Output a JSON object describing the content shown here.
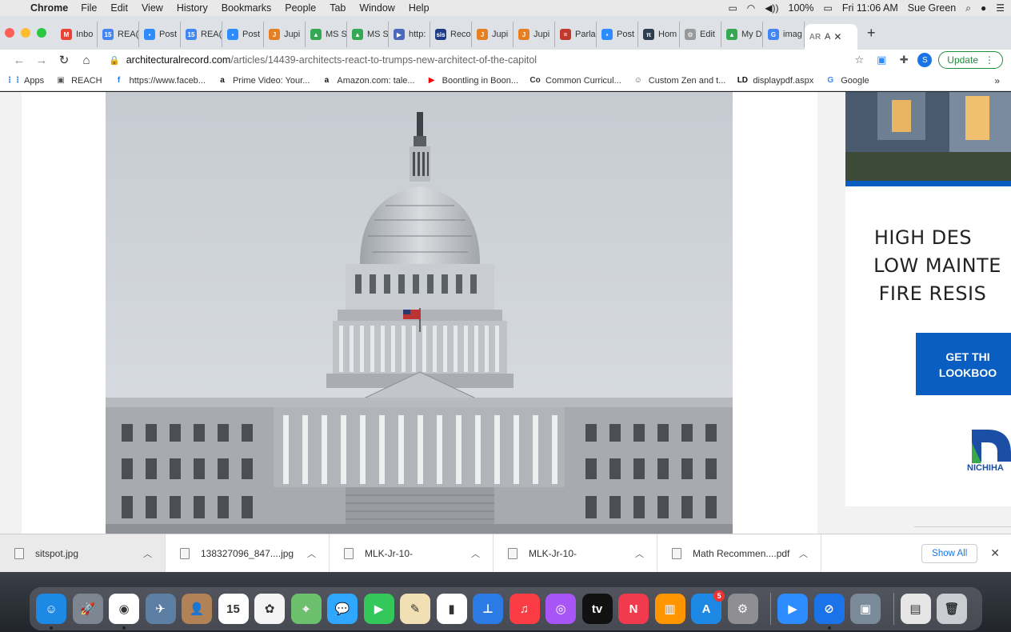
{
  "menubar": {
    "app_name": "Chrome",
    "items": [
      "File",
      "Edit",
      "View",
      "History",
      "Bookmarks",
      "People",
      "Tab",
      "Window",
      "Help"
    ],
    "battery": "100%",
    "clock": "Fri 11:06 AM",
    "user": "Sue Green"
  },
  "tabs": [
    {
      "label": "Inbo",
      "icon": "gmail-icon",
      "color": "#ea4335",
      "glyph": "M"
    },
    {
      "label": "REA(",
      "icon": "calendar-icon",
      "color": "#4285f4",
      "glyph": "15"
    },
    {
      "label": "Post",
      "icon": "zoom-icon",
      "color": "#2d8cff",
      "glyph": "▪"
    },
    {
      "label": "REA(",
      "icon": "calendar-icon",
      "color": "#4285f4",
      "glyph": "15"
    },
    {
      "label": "Post",
      "icon": "zoom-icon",
      "color": "#2d8cff",
      "glyph": "▪"
    },
    {
      "label": "Jupi",
      "icon": "jupiter-icon",
      "color": "#e67e22",
      "glyph": "J"
    },
    {
      "label": "MS S",
      "icon": "drive-icon",
      "color": "#34a853",
      "glyph": "▲"
    },
    {
      "label": "MS S",
      "icon": "drive-icon",
      "color": "#34a853",
      "glyph": "▲"
    },
    {
      "label": "http:",
      "icon": "play-icon",
      "color": "#4a69bd",
      "glyph": "▶"
    },
    {
      "label": "Reco",
      "icon": "sis-icon",
      "color": "#1f3c88",
      "glyph": "sis"
    },
    {
      "label": "Jupi",
      "icon": "jupiter-icon",
      "color": "#e67e22",
      "glyph": "J"
    },
    {
      "label": "Jupi",
      "icon": "jupiter-icon",
      "color": "#e67e22",
      "glyph": "J"
    },
    {
      "label": "Parla",
      "icon": "parla-icon",
      "color": "#c0392b",
      "glyph": "="
    },
    {
      "label": "Post",
      "icon": "zoom-icon",
      "color": "#2d8cff",
      "glyph": "▪"
    },
    {
      "label": "Hom",
      "icon": "home-icon",
      "color": "#2c3e50",
      "glyph": "π"
    },
    {
      "label": "Edit",
      "icon": "settings-icon",
      "color": "#999999",
      "glyph": "⚙"
    },
    {
      "label": "My D",
      "icon": "drive-icon",
      "color": "#34a853",
      "glyph": "▲"
    },
    {
      "label": "imag",
      "icon": "google-icon",
      "color": "#4285f4",
      "glyph": "G"
    }
  ],
  "active_tab": {
    "label": "AR A",
    "prefix": "AR"
  },
  "url": {
    "domain": "architecturalrecord.com",
    "path": "/articles/14439-architects-react-to-trumps-new-architect-of-the-capitol"
  },
  "update_button": "Update",
  "profile_initial": "S",
  "bookmarks": [
    {
      "label": "Apps",
      "icon": "apps-grid-icon",
      "glyph": "⋮⋮",
      "color": "#1a73e8"
    },
    {
      "label": "REACH",
      "icon": "folder-icon",
      "glyph": "▣",
      "color": "#555555"
    },
    {
      "label": "https://www.faceb...",
      "icon": "facebook-icon",
      "glyph": "f",
      "color": "#1877f2"
    },
    {
      "label": "Prime Video: Your...",
      "icon": "amazon-icon",
      "glyph": "a",
      "color": "#111111"
    },
    {
      "label": "Amazon.com: tale...",
      "icon": "amazon-icon",
      "glyph": "a",
      "color": "#111111"
    },
    {
      "label": "Boontling in Boon...",
      "icon": "youtube-icon",
      "glyph": "▶",
      "color": "#ff0000"
    },
    {
      "label": "Common Curricul...",
      "icon": "cc-icon",
      "glyph": "Co",
      "color": "#333333"
    },
    {
      "label": "Custom Zen and t...",
      "icon": "zen-icon",
      "glyph": "☺",
      "color": "#555555"
    },
    {
      "label": "displaypdf.aspx",
      "icon": "ld-icon",
      "glyph": "LD",
      "color": "#111111"
    },
    {
      "label": "Google",
      "icon": "google-icon",
      "glyph": "G",
      "color": "#4285f4"
    }
  ],
  "ad": {
    "lines": [
      "HIGH DES",
      "LOW MAINTE",
      "FIRE RESIS"
    ],
    "cta_line1": "GET THI",
    "cta_line2": "LOOKBOO",
    "logo_text": "NICHIHA",
    "accent": "#0a5ec2"
  },
  "downloads": [
    {
      "name": "sitspot.jpg"
    },
    {
      "name": "138327096_847....jpg"
    },
    {
      "name": "MLK-Jr-10-"
    },
    {
      "name": "MLK-Jr-10-"
    },
    {
      "name": "Math Recommen....pdf"
    }
  ],
  "show_all": "Show All",
  "dock": [
    {
      "name": "finder-icon",
      "bg": "#1e88e5",
      "glyph": "☺",
      "dot": true
    },
    {
      "name": "launchpad-icon",
      "bg": "#7d8590",
      "glyph": "🚀",
      "dot": false
    },
    {
      "name": "chrome-icon",
      "bg": "#ffffff",
      "glyph": "◉",
      "dot": true
    },
    {
      "name": "preview-icon",
      "bg": "#5d7fa3",
      "glyph": "✈",
      "dot": false
    },
    {
      "name": "contacts-icon",
      "bg": "#b08255",
      "glyph": "👤",
      "dot": false
    },
    {
      "name": "calendar-icon",
      "bg": "#ffffff",
      "glyph": "15",
      "dot": false
    },
    {
      "name": "photos-icon",
      "bg": "#f4f4f4",
      "glyph": "✿",
      "dot": false
    },
    {
      "name": "maps-icon",
      "bg": "#6cbf6c",
      "glyph": "⌖",
      "dot": false
    },
    {
      "name": "messages-icon",
      "bg": "#2fa7ff",
      "glyph": "💬",
      "dot": false
    },
    {
      "name": "facetime-icon",
      "bg": "#34c759",
      "glyph": "▶",
      "dot": false
    },
    {
      "name": "textedit-icon",
      "bg": "#f1e0b4",
      "glyph": "✎",
      "dot": false
    },
    {
      "name": "numbers-icon",
      "bg": "#ffffff",
      "glyph": "▮",
      "dot": false
    },
    {
      "name": "keynote-icon",
      "bg": "#2c7be5",
      "glyph": "⊥",
      "dot": false
    },
    {
      "name": "music-icon",
      "bg": "#fc3c44",
      "glyph": "♫",
      "dot": false
    },
    {
      "name": "podcasts-icon",
      "bg": "#a855f7",
      "glyph": "◎",
      "dot": false
    },
    {
      "name": "apple-tv-icon",
      "bg": "#111111",
      "glyph": "tv",
      "dot": false
    },
    {
      "name": "news-icon",
      "bg": "#f23a4f",
      "glyph": "N",
      "dot": false
    },
    {
      "name": "books-icon",
      "bg": "#ff9500",
      "glyph": "▥",
      "dot": false
    },
    {
      "name": "app-store-icon",
      "bg": "#1e88e5",
      "glyph": "A",
      "badge": "5",
      "dot": false
    },
    {
      "name": "system-preferences-icon",
      "bg": "#8e8e93",
      "glyph": "⚙",
      "dot": false
    },
    {
      "sep": true
    },
    {
      "name": "zoom-icon",
      "bg": "#2d8cff",
      "glyph": "▶",
      "dot": false
    },
    {
      "name": "safari-icon",
      "bg": "#1a73e8",
      "glyph": "⊘",
      "dot": true
    },
    {
      "name": "image-capture-icon",
      "bg": "#7a8a99",
      "glyph": "▣",
      "dot": false
    },
    {
      "sep": true
    },
    {
      "name": "downloads-stack-icon",
      "bg": "#e6e6e6",
      "glyph": "▤",
      "dot": false
    },
    {
      "name": "trash-icon",
      "bg": "#c9ccd1",
      "glyph": "🗑",
      "dot": false
    }
  ]
}
